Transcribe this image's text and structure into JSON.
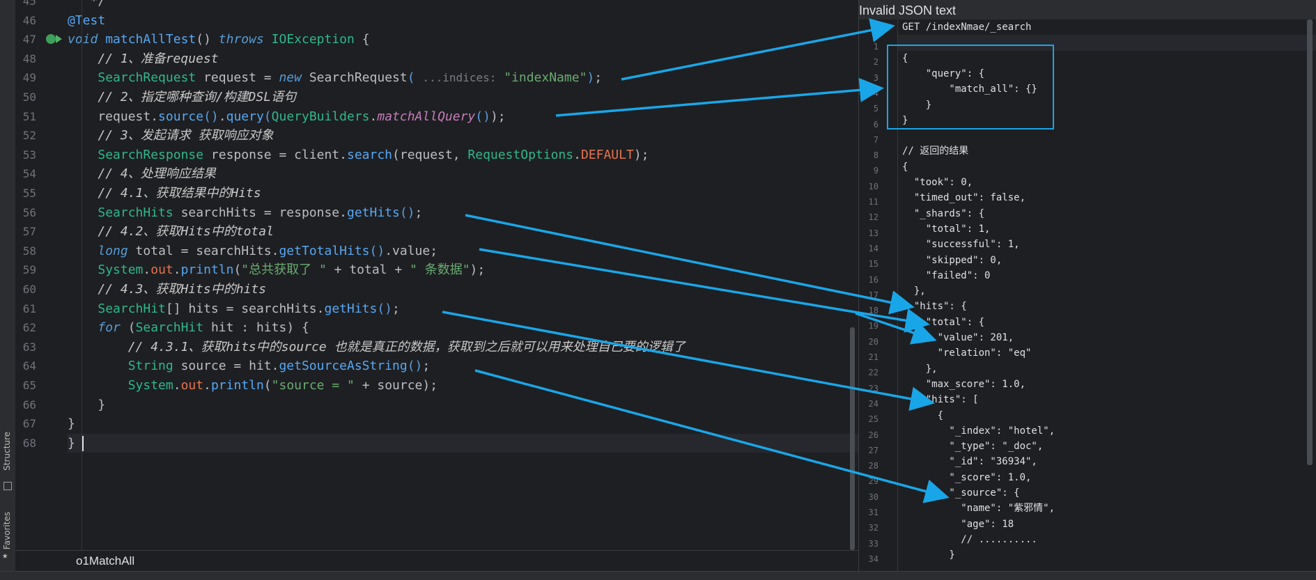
{
  "sidebar": {
    "structure_label": "Structure",
    "favorites_label": "Favorites"
  },
  "editor": {
    "file_tab": "o1MatchAll",
    "first_line": 45,
    "lines": [
      [
        [
          "t",
          "   */"
        ]
      ],
      [
        [
          "ann",
          "@Test"
        ]
      ],
      [
        [
          "kw",
          "void"
        ],
        [
          "t",
          " "
        ],
        [
          "fn",
          "matchAllTest"
        ],
        [
          "t",
          "() "
        ],
        [
          "kw",
          "throws"
        ],
        [
          "t",
          " "
        ],
        [
          "cls",
          "IOException"
        ],
        [
          "t",
          " {"
        ]
      ],
      [
        [
          "t",
          "    "
        ],
        [
          "cmt",
          "// 1、准备request"
        ]
      ],
      [
        [
          "t",
          "    "
        ],
        [
          "cls",
          "SearchRequest"
        ],
        [
          "t",
          " request = "
        ],
        [
          "kw",
          "new"
        ],
        [
          "t",
          " SearchRequest"
        ],
        [
          "tg",
          "("
        ],
        [
          "t",
          " "
        ],
        [
          "hint",
          "...indices:"
        ],
        [
          "t",
          " "
        ],
        [
          "str",
          "\"indexName\""
        ],
        [
          "tg",
          ")"
        ],
        [
          "t",
          ";"
        ]
      ],
      [
        [
          "t",
          "    "
        ],
        [
          "cmt",
          "// 2、指定哪种查询/构建DSL语句"
        ]
      ],
      [
        [
          "t",
          "    request."
        ],
        [
          "fn",
          "source"
        ],
        [
          "tg",
          "()"
        ],
        [
          "t",
          "."
        ],
        [
          "fn",
          "query"
        ],
        [
          "tg",
          "("
        ],
        [
          "cls",
          "QueryBuilders"
        ],
        [
          "t",
          "."
        ],
        [
          "stat",
          "matchAllQuery"
        ],
        [
          "tg",
          "()"
        ],
        [
          "t",
          ");"
        ]
      ],
      [
        [
          "t",
          "    "
        ],
        [
          "cmt",
          "// 3、发起请求 获取响应对象"
        ]
      ],
      [
        [
          "t",
          "    "
        ],
        [
          "cls",
          "SearchResponse"
        ],
        [
          "t",
          " response = client."
        ],
        [
          "fn",
          "search"
        ],
        [
          "t",
          "(request, "
        ],
        [
          "cls",
          "RequestOptions"
        ],
        [
          "t",
          "."
        ],
        [
          "const",
          "DEFAULT"
        ],
        [
          "t",
          ");"
        ]
      ],
      [
        [
          "t",
          "    "
        ],
        [
          "cmt",
          "// 4、处理响应结果"
        ]
      ],
      [
        [
          "t",
          "    "
        ],
        [
          "cmt",
          "// 4.1、获取结果中的Hits"
        ]
      ],
      [
        [
          "t",
          "    "
        ],
        [
          "cls",
          "SearchHits"
        ],
        [
          "t",
          " searchHits = response."
        ],
        [
          "fn",
          "getHits"
        ],
        [
          "tg",
          "()"
        ],
        [
          "t",
          ";"
        ]
      ],
      [
        [
          "t",
          "    "
        ],
        [
          "cmt",
          "// 4.2、获取Hits中的total"
        ]
      ],
      [
        [
          "t",
          "    "
        ],
        [
          "kw",
          "long"
        ],
        [
          "t",
          " total = searchHits."
        ],
        [
          "fn",
          "getTotalHits"
        ],
        [
          "tg",
          "()"
        ],
        [
          "t",
          ".value;"
        ]
      ],
      [
        [
          "t",
          "    "
        ],
        [
          "cls",
          "System"
        ],
        [
          "t",
          "."
        ],
        [
          "const",
          "out"
        ],
        [
          "t",
          "."
        ],
        [
          "fn",
          "println"
        ],
        [
          "t",
          "("
        ],
        [
          "str",
          "\"总共获取了 \""
        ],
        [
          "t",
          " + total + "
        ],
        [
          "str",
          "\" 条数据\""
        ],
        [
          "t",
          ");"
        ]
      ],
      [
        [
          "t",
          "    "
        ],
        [
          "cmt",
          "// 4.3、获取Hits中的hits"
        ]
      ],
      [
        [
          "t",
          "    "
        ],
        [
          "cls",
          "SearchHit"
        ],
        [
          "t",
          "[] hits = searchHits."
        ],
        [
          "fn",
          "getHits"
        ],
        [
          "tg",
          "()"
        ],
        [
          "t",
          ";"
        ]
      ],
      [
        [
          "t",
          "    "
        ],
        [
          "kw",
          "for"
        ],
        [
          "t",
          " ("
        ],
        [
          "cls",
          "SearchHit"
        ],
        [
          "t",
          " hit : hits) {"
        ]
      ],
      [
        [
          "t",
          "        "
        ],
        [
          "cmt",
          "// 4.3.1、获取hits中的source 也就是真正的数据，获取到之后就可以用来处理自己要的逻辑了"
        ]
      ],
      [
        [
          "t",
          "        "
        ],
        [
          "cls",
          "String"
        ],
        [
          "t",
          " source = hit."
        ],
        [
          "fn",
          "getSourceAsString"
        ],
        [
          "tg",
          "()"
        ],
        [
          "t",
          ";"
        ]
      ],
      [
        [
          "t",
          "        "
        ],
        [
          "cls",
          "System"
        ],
        [
          "t",
          "."
        ],
        [
          "const",
          "out"
        ],
        [
          "t",
          "."
        ],
        [
          "fn",
          "println"
        ],
        [
          "t",
          "("
        ],
        [
          "str",
          "\"source = \""
        ],
        [
          "t",
          " + source);"
        ]
      ],
      [
        [
          "t",
          "    }"
        ]
      ],
      [
        [
          "t",
          "}"
        ]
      ],
      [
        [
          "t",
          "}"
        ]
      ]
    ]
  },
  "json_panel": {
    "title": "Invalid JSON text",
    "lines": [
      "GET /indexNmae/_search",
      "",
      "{",
      "    \"query\": {",
      "        \"match_all\": {}",
      "    }",
      "}",
      "",
      "// 返回的结果",
      "{",
      "  \"took\": 0,",
      "  \"timed_out\": false,",
      "  \"_shards\": {",
      "    \"total\": 1,",
      "    \"successful\": 1,",
      "    \"skipped\": 0,",
      "    \"failed\": 0",
      "  },",
      "  \"hits\": {",
      "    \"total\": {",
      "      \"value\": 201,",
      "      \"relation\": \"eq\"",
      "    },",
      "    \"max_score\": 1.0,",
      "    \"hits\": [",
      "      {",
      "        \"_index\": \"hotel\",",
      "        \"_type\": \"_doc\",",
      "        \"_id\": \"36934\",",
      "        \"_score\": 1.0,",
      "        \"_source\": {",
      "          \"name\": \"紫邪情\",",
      "          \"age\": 18",
      "          // ..........",
      "        }"
    ]
  },
  "colors": {
    "arrow": "#19a6e8",
    "editor_bg": "#1e1f22"
  }
}
